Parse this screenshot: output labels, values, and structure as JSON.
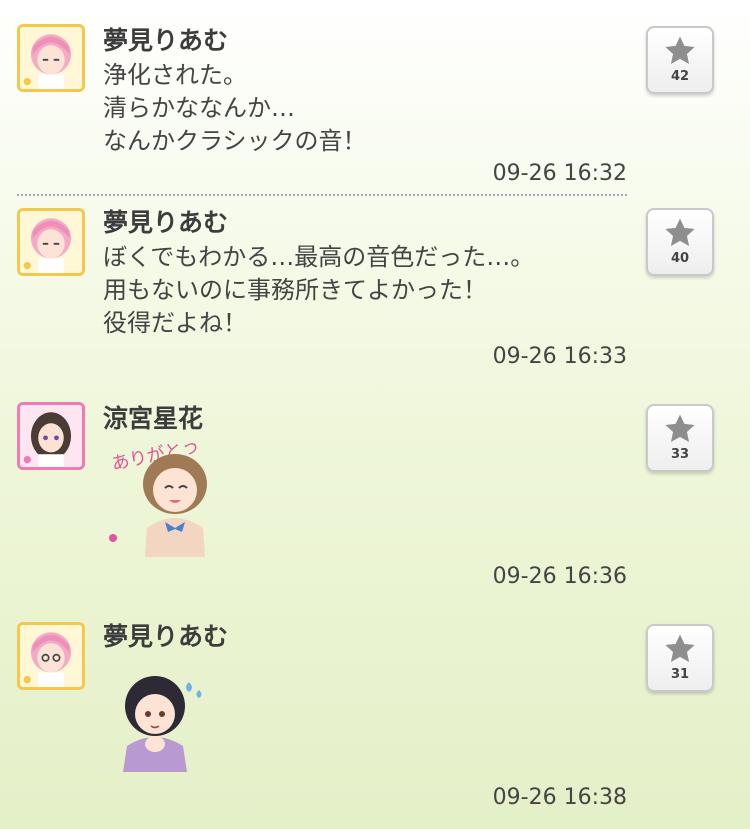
{
  "colors": {
    "name_text": "#3c3c3c",
    "star": "#8e8e8e",
    "avatar_border_yellow": "#f2c94c",
    "avatar_border_pink": "#f07ab4",
    "sticker_text": "#e2559c"
  },
  "posts": [
    {
      "author": "夢見りあむ",
      "message": "浄化された。\n清らかななんか…\nなんかクラシックの音！",
      "timestamp": "09-26 16:32",
      "likes": "42",
      "avatar_icon": "riamu-avatar-icon"
    },
    {
      "author": "夢見りあむ",
      "message": "ぼくでもわかる…最高の音色だった…。\n用もないのに事務所きてよかった！\n役得だよね！",
      "timestamp": "09-26 16:33",
      "likes": "40",
      "avatar_icon": "riamu-avatar-icon"
    },
    {
      "author": "涼宮星花",
      "sticker": {
        "text": "ありがとう",
        "icon": "thank-you-sticker-icon"
      },
      "timestamp": "09-26 16:36",
      "likes": "33",
      "avatar_icon": "seika-avatar-icon"
    },
    {
      "author": "夢見りあむ",
      "sticker": {
        "icon": "nervous-sticker-icon"
      },
      "timestamp": "09-26 16:38",
      "likes": "31",
      "avatar_icon": "riamu-avatar-icon"
    }
  ]
}
